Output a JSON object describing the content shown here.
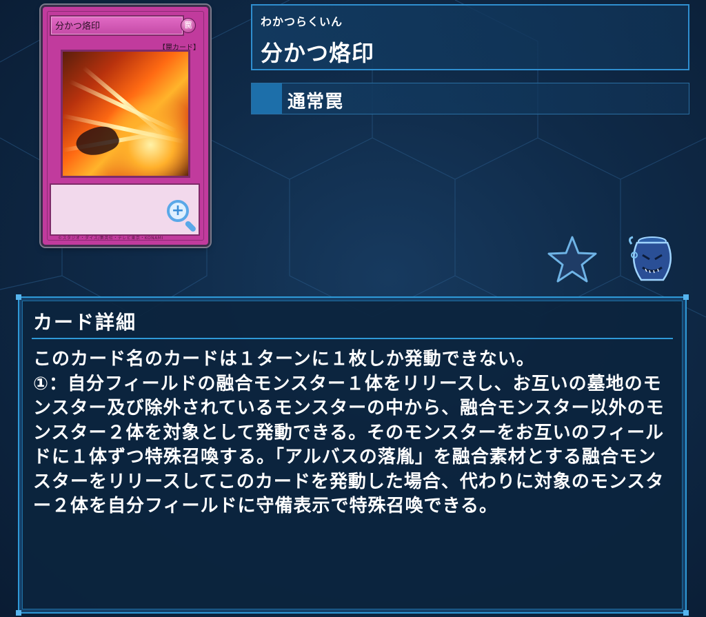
{
  "card": {
    "name_reading": "わかつらくいん",
    "name": "分かつ烙印",
    "type": "通常罠",
    "thumbnail": {
      "name": "分かつ烙印",
      "type_tag": "【罠カード】",
      "attribute_symbol": "罠",
      "footer": "©スタジオ・ダイス/集英社・テレビ東京・KONAMI"
    }
  },
  "details": {
    "title": "カード詳細",
    "text": "このカード名のカードは１ターンに１枚しか発動できない。\n①：自分フィールドの融合モンスター１体をリリースし、お互いの墓地のモンスター及び除外されているモンスターの中から、融合モンスター以外のモンスター２体を対象として発動できる。そのモンスターをお互いのフィールドに１体ずつ特殊召喚する。「アルバスの落胤」を融合素材とする融合モンスターをリリースしてこのカードを発動した場合、代わりに対象のモンスター２体を自分フィールドに守備表示で特殊召喚できる。"
  },
  "icons": {
    "zoom": "zoom-in-icon",
    "favorite": "star-icon",
    "pot": "pot-of-greed-icon"
  },
  "colors": {
    "trap_card": "#c13b9d",
    "panel_border": "#2f9ad8",
    "type_square": "#1d6faa"
  }
}
